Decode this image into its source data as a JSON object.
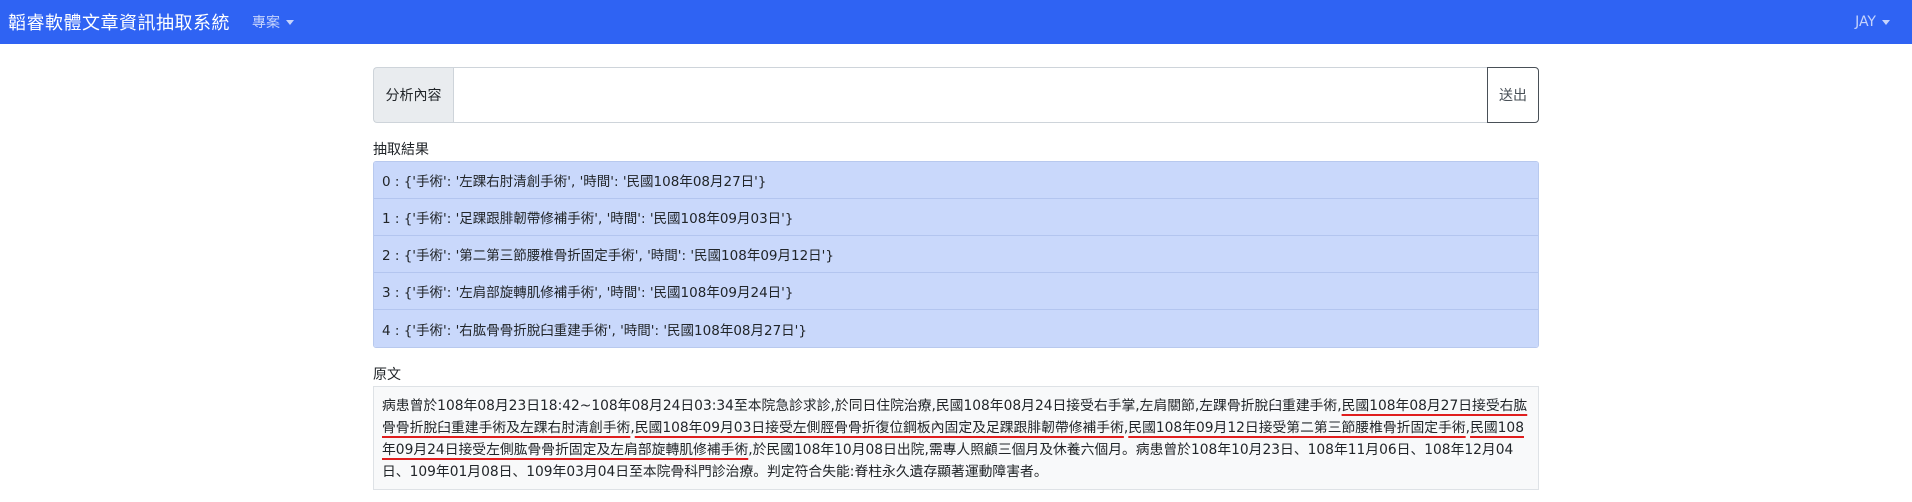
{
  "navbar": {
    "brand": "韜睿軟體文章資訊抽取系統",
    "menu_label": "專案",
    "user_label": "JAY"
  },
  "form": {
    "input_label": "分析內容",
    "input_value": "",
    "submit_label": "送出"
  },
  "results": {
    "heading": "抽取結果",
    "items": [
      "0 : {'手術': '左踝右肘清創手術', '時間': '民國108年08月27日'}",
      "1 : {'手術': '足踝跟腓韌帶修補手術', '時間': '民國108年09月03日'}",
      "2 : {'手術': '第二第三節腰椎骨折固定手術', '時間': '民國108年09月12日'}",
      "3 : {'手術': '左肩部旋轉肌修補手術', '時間': '民國108年09月24日'}",
      "4 : {'手術': '右肱骨骨折脫臼重建手術', '時間': '民國108年08月27日'}"
    ]
  },
  "original": {
    "heading": "原文",
    "segments": [
      "病患曾於108年08月23日18:42~108年08月24日03:34至本院急診求診,於同日住院治療,民國108年08月24日接受右手掌,左肩關節,左踝骨折脫臼重建手術,",
      "民國108年08月27日接受右肱骨骨折脫臼重建手術及左踝右肘清創手術",
      ",",
      "民國108年09月03日接受左側脛骨骨折復位鋼板內固定及足踝跟腓韌帶修補手術",
      ",",
      "民國108年09月12日接受第二第三節腰椎骨折固定手術",
      ",",
      "民國108年09月24日接受左側肱骨骨折固定及左肩部旋轉肌修補手術",
      ",於民國108年10月08日出院,需專人照顧三個月及休養六個月。病患曾於108年10月23日、108年11月06日、108年12月04日、109年01月08日、109年03月04日至本院骨科門診治療。判定符合失能:脊柱永久遺存顯著運動障害者。"
    ],
    "highlight_color": "#e01e1e"
  },
  "colors": {
    "navbar": "#2f63f3",
    "result_bg": "#c9d8fb"
  }
}
